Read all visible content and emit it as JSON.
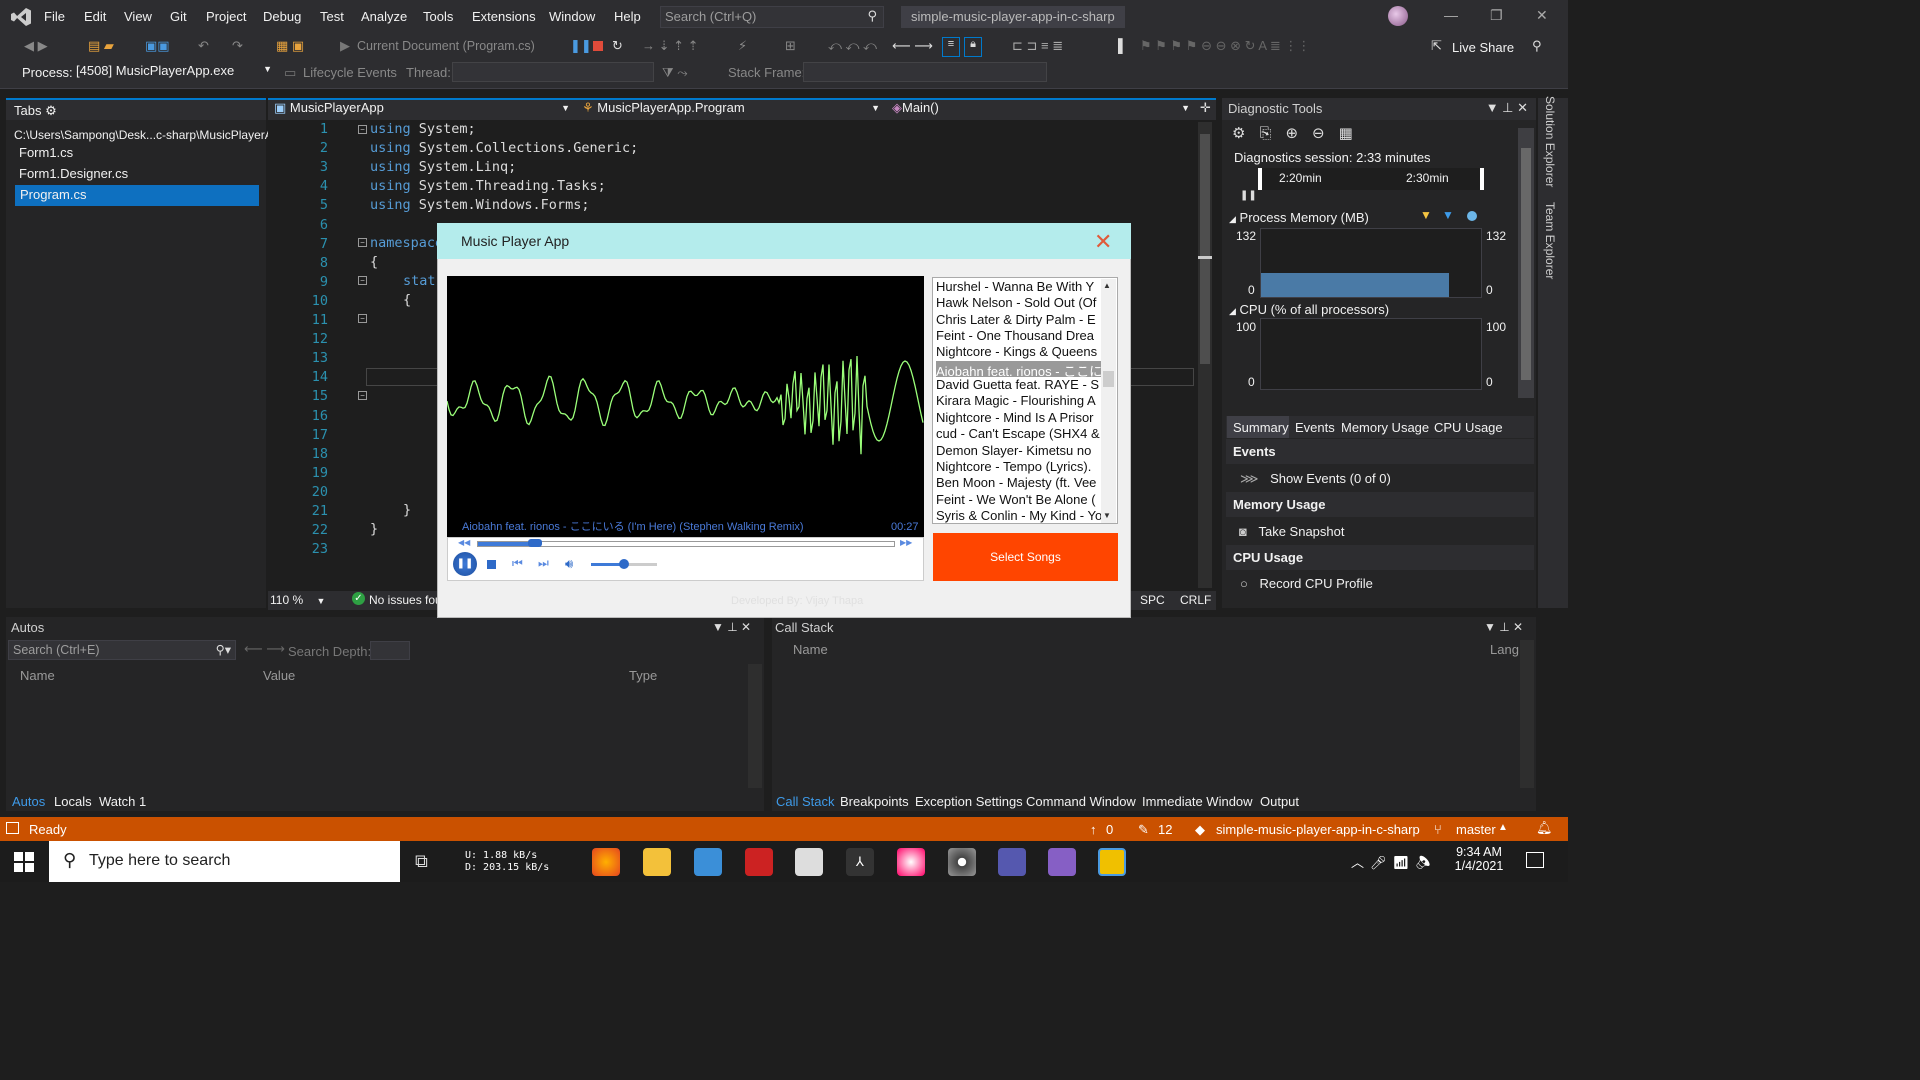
{
  "menu": {
    "items": [
      "File",
      "Edit",
      "View",
      "Git",
      "Project",
      "Debug",
      "Test",
      "Analyze",
      "Tools",
      "Extensions",
      "Window",
      "Help"
    ],
    "search_placeholder": "Search (Ctrl+Q)",
    "solution": "simple-music-player-app-in-c-sharp"
  },
  "toolbar": {
    "current_document": "Current Document (Program.cs)",
    "live_share": "Live Share"
  },
  "debugbar": {
    "process_label": "Process:",
    "process": "[4508] MusicPlayerApp.exe",
    "lifecycle": "Lifecycle Events",
    "thread_label": "Thread:",
    "stack_label": "Stack Frame:"
  },
  "tabs_panel": {
    "title": "Tabs",
    "path": "C:\\Users\\Sampong\\Desk...c-sharp\\MusicPlayerApp",
    "files": [
      "Form1.cs",
      "Form1.Designer.cs",
      "Program.cs"
    ],
    "selected_index": 2
  },
  "editor": {
    "project_combo": "MusicPlayerApp",
    "class_combo": "MusicPlayerApp.Program",
    "member_combo": "Main()",
    "line_numbers": [
      "1",
      "2",
      "3",
      "4",
      "5",
      "6",
      "7",
      "8",
      "9",
      "10",
      "11",
      "12",
      "13",
      "14",
      "15",
      "16",
      "17",
      "18",
      "19",
      "20",
      "21",
      "22",
      "23"
    ],
    "code": [
      {
        "kw": "using",
        "rest": " System;"
      },
      {
        "kw": "using",
        "rest": " System.Collections.Generic;"
      },
      {
        "kw": "using",
        "rest": " System.Linq;"
      },
      {
        "kw": "using",
        "rest": " System.Threading.Tasks;"
      },
      {
        "kw": "using",
        "rest": " System.Windows.Forms;"
      }
    ],
    "namespace_kw": "namespace",
    "brace_open": "{",
    "stat_fragment": "stat",
    "inner_brace": "{",
    "close_brace": "}",
    "outer_close": "}",
    "zoom": "110 %",
    "issues": "No issues fou",
    "spc": "SPC",
    "crlf": "CRLF"
  },
  "diagnostics": {
    "title": "Diagnostic Tools",
    "session": "Diagnostics session: 2:33 minutes",
    "timeline_labels": [
      "2:20min",
      "2:30min"
    ],
    "memory_title": "Process Memory (MB)",
    "memory_max": "132",
    "memory_min": "0",
    "cpu_title": "CPU (% of all processors)",
    "cpu_max": "100",
    "cpu_min": "0",
    "tabs": [
      "Summary",
      "Events",
      "Memory Usage",
      "CPU Usage"
    ],
    "events_header": "Events",
    "show_events": "Show Events (0 of 0)",
    "memory_header": "Memory Usage",
    "take_snapshot": "Take Snapshot",
    "cpu_header": "CPU Usage",
    "record_cpu": "Record CPU Profile"
  },
  "side_tabs": [
    "Solution Explorer",
    "Team Explorer"
  ],
  "autos": {
    "title": "Autos",
    "search_placeholder": "Search (Ctrl+E)",
    "search_depth": "Search Depth:",
    "columns": [
      "Name",
      "Value",
      "Type"
    ],
    "tabs": [
      "Autos",
      "Locals",
      "Watch 1"
    ]
  },
  "callstack": {
    "title": "Call Stack",
    "columns": [
      "Name",
      "Lang"
    ],
    "tabs": [
      "Call Stack",
      "Breakpoints",
      "Exception Settings",
      "Command Window",
      "Immediate Window",
      "Output"
    ]
  },
  "statusbar": {
    "ready": "Ready",
    "up_count": "0",
    "edit_count": "12",
    "repo": "simple-music-player-app-in-c-sharp",
    "branch": "master"
  },
  "taskbar": {
    "search_placeholder": "Type here to search",
    "net_up": "U:  1.88 kB/s",
    "net_down": "D:  203.15 kB/s",
    "time": "9:34 AM",
    "date": "1/4/2021"
  },
  "music_player": {
    "title": "Music Player App",
    "now_playing": "Aiobahn feat. rionos - ここにいる (I'm Here) (Stephen Walking Remix)",
    "elapsed": "00:27",
    "progress": 0.15,
    "volume": 0.5,
    "songs": [
      "Hurshel - Wanna Be With Y",
      "Hawk Nelson - Sold Out (Of",
      "Chris Later & Dirty Palm - E",
      "Feint - One Thousand Drea",
      "Nightcore - Kings & Queens",
      "Aiobahn feat. rionos - ここに",
      "David Guetta feat. RAYE - S",
      "Kirara Magic - Flourishing A",
      "Nightcore - Mind Is A Prisor",
      "cud - Can't Escape (SHX4 &",
      "Demon Slayer- Kimetsu no",
      "Nightcore - Tempo (Lyrics).",
      "Ben Moon - Majesty (ft. Vee",
      "Feint - We Won't Be Alone (",
      "Syris & Conlin - My Kind - Yo"
    ],
    "selected_song_index": 5,
    "select_button": "Select Songs",
    "footer": "Developed By: Vijay Thapa",
    "accent": "#ff4500",
    "title_bg": "#b4ecec",
    "wave_color": "#9bff7a"
  }
}
